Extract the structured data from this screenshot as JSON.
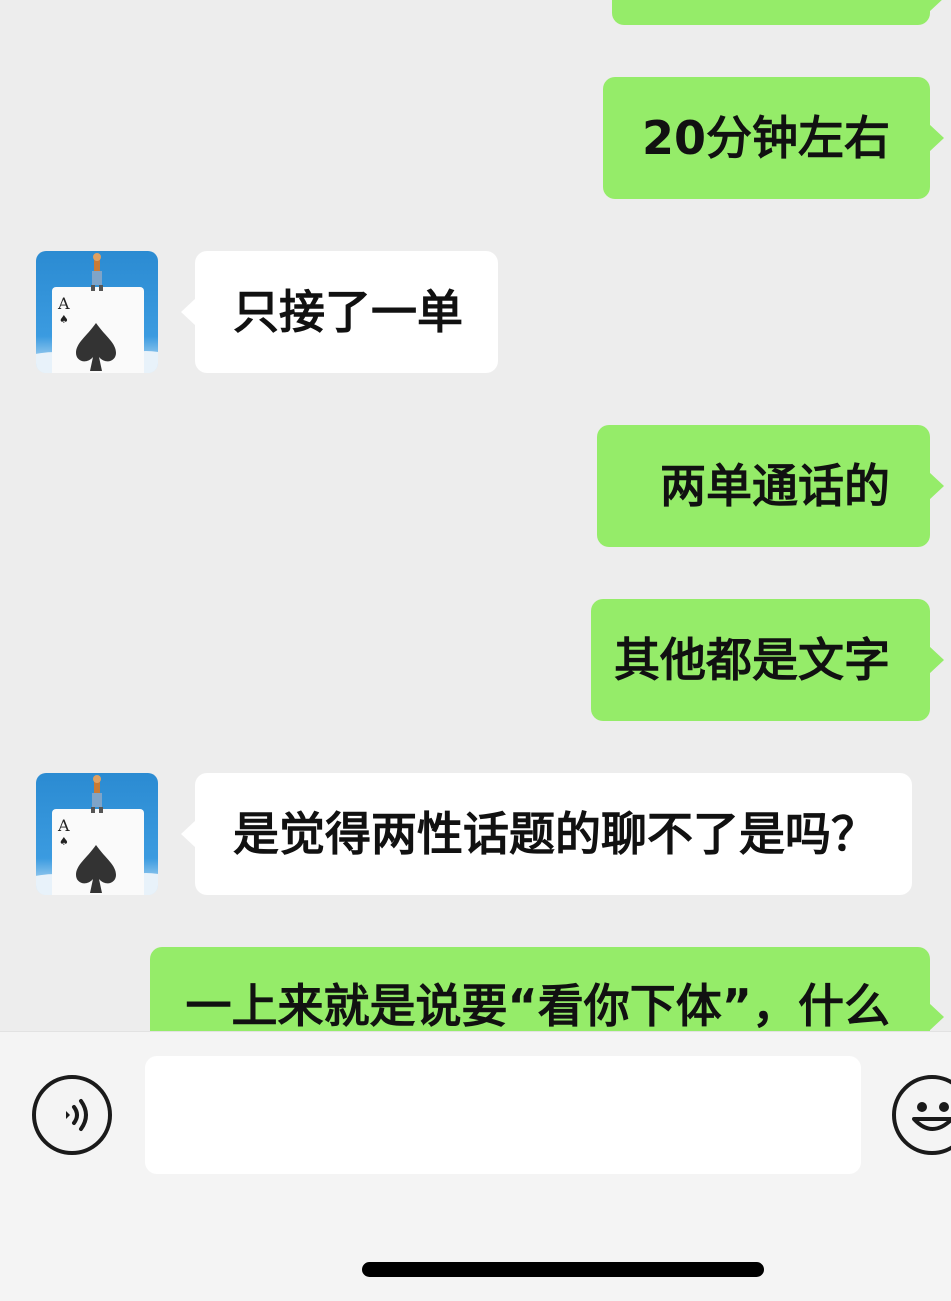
{
  "messages": [
    {
      "side": "out",
      "text": ""
    },
    {
      "side": "out",
      "text": "20分钟左右"
    },
    {
      "side": "in",
      "text": "只接了一单"
    },
    {
      "side": "out",
      "text": "两单通话的"
    },
    {
      "side": "out",
      "text": "其他都是文字"
    },
    {
      "side": "in",
      "text": "是觉得两性话题的聊不了是吗？"
    },
    {
      "side": "out",
      "text": "一上来就是说要“看你下体”，什么"
    }
  ],
  "input": {
    "value": "",
    "placeholder": ""
  },
  "icons": {
    "voice": "voice-icon",
    "emoji": "emoji-icon",
    "avatar": "avatar-ace-of-spades"
  },
  "colors": {
    "out_bubble": "#95ec69",
    "in_bubble": "#ffffff",
    "background": "#ededed"
  }
}
